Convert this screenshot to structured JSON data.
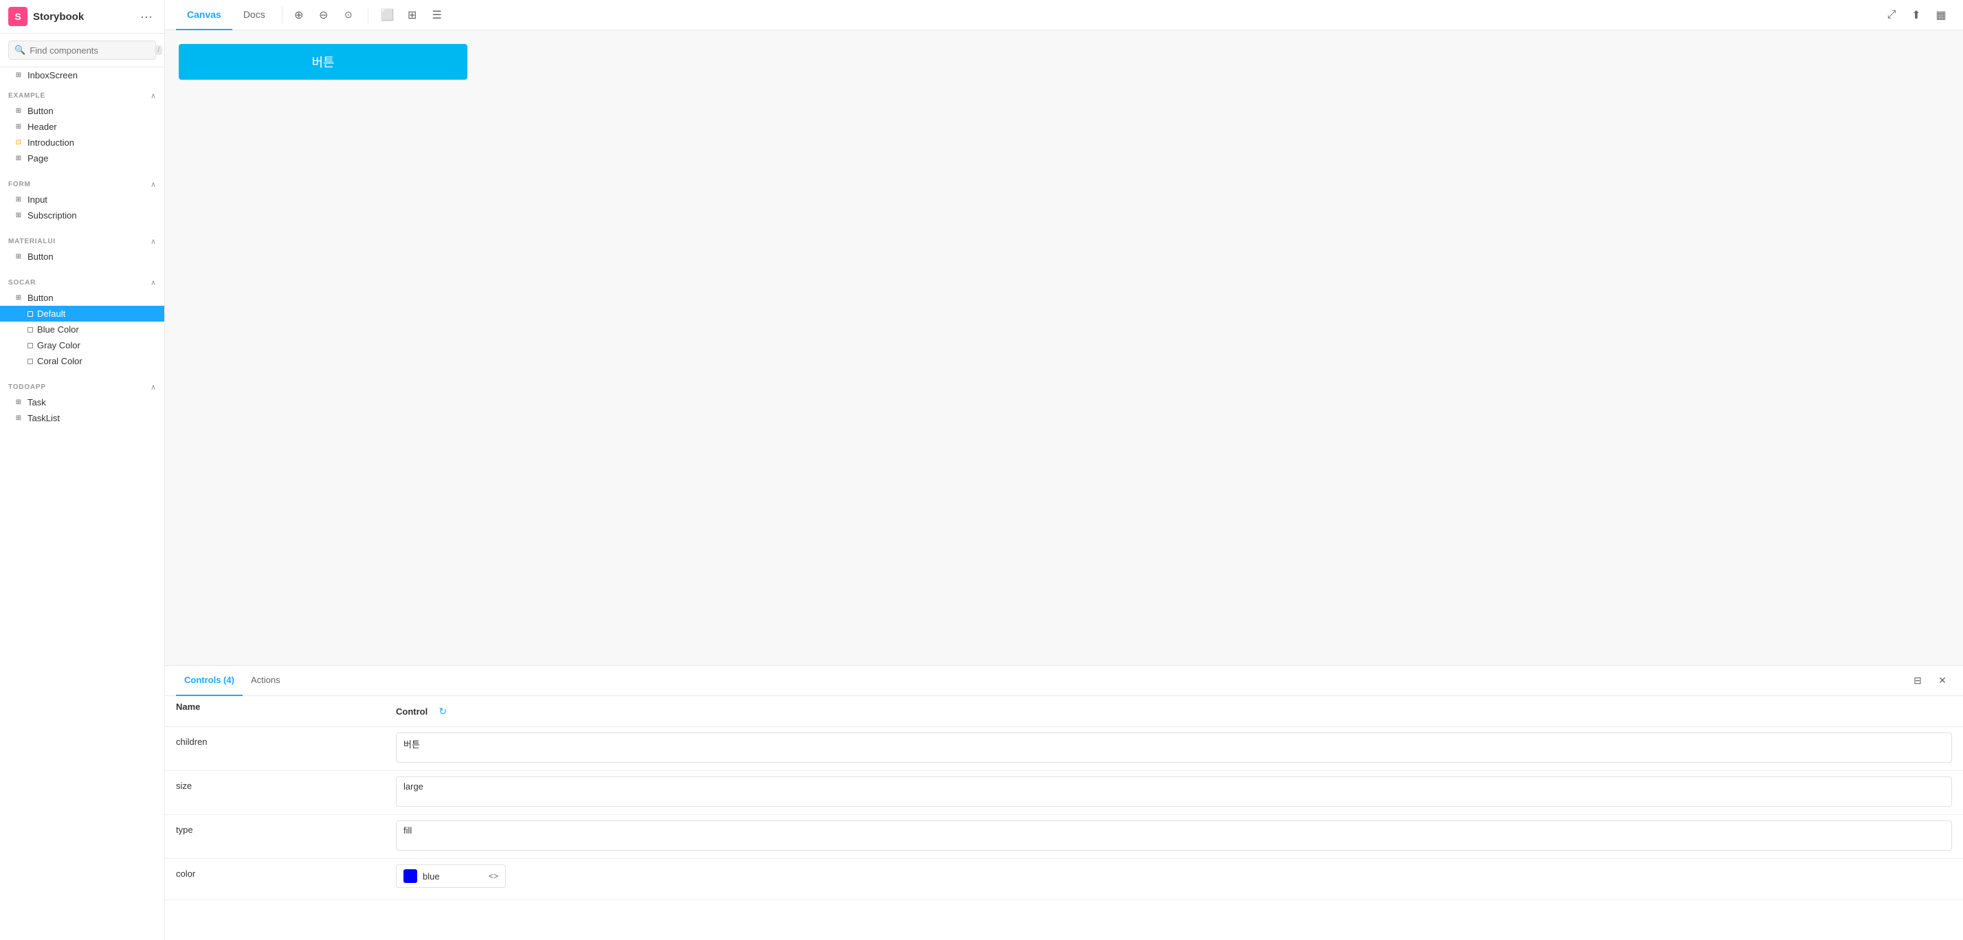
{
  "app": {
    "name": "Storybook",
    "logo_letter": "S"
  },
  "topbar": {
    "tabs": [
      {
        "label": "Canvas",
        "active": true
      },
      {
        "label": "Docs",
        "active": false
      }
    ],
    "tools": [
      "zoom-in",
      "zoom-out",
      "zoom-reset",
      "image-icon",
      "grid-icon",
      "layout-icon"
    ],
    "right_tools": [
      "expand-icon",
      "share-icon",
      "sidebar-icon"
    ]
  },
  "search": {
    "placeholder": "Find components",
    "shortcut": "/"
  },
  "sidebar": {
    "inbox": "InboxScreen",
    "sections": [
      {
        "title": "EXAMPLE",
        "collapsible": true,
        "items": [
          {
            "label": "Button",
            "icon": "book"
          },
          {
            "label": "Header",
            "icon": "book"
          },
          {
            "label": "Introduction",
            "icon": "orange"
          },
          {
            "label": "Page",
            "icon": "book"
          }
        ]
      },
      {
        "title": "FORM",
        "collapsible": true,
        "items": [
          {
            "label": "Input",
            "icon": "book"
          },
          {
            "label": "Subscription",
            "icon": "book"
          }
        ]
      },
      {
        "title": "MATERIALUI",
        "collapsible": true,
        "items": [
          {
            "label": "Button",
            "icon": "book"
          }
        ]
      },
      {
        "title": "SOCAR",
        "collapsible": true,
        "items": [
          {
            "label": "Button",
            "icon": "book",
            "expanded": true,
            "sub_items": [
              {
                "label": "Default",
                "active": true
              },
              {
                "label": "Blue Color",
                "active": false
              },
              {
                "label": "Gray Color",
                "active": false
              },
              {
                "label": "Coral Color",
                "active": false
              }
            ]
          }
        ]
      },
      {
        "title": "TODOAPP",
        "collapsible": true,
        "items": [
          {
            "label": "Task",
            "icon": "book"
          },
          {
            "label": "TaskList",
            "icon": "book"
          }
        ]
      }
    ]
  },
  "canvas": {
    "button_text": "버튼",
    "button_color": "#00b8f1"
  },
  "controls": {
    "tab_label": "Controls (4)",
    "actions_label": "Actions",
    "column_name": "Name",
    "column_control": "Control",
    "rows": [
      {
        "name": "children",
        "value": "버튼",
        "type": "textarea"
      },
      {
        "name": "size",
        "value": "large",
        "type": "textarea"
      },
      {
        "name": "type",
        "value": "fill",
        "type": "textarea"
      },
      {
        "name": "color",
        "value": "blue",
        "type": "color",
        "color": "#0000ff"
      }
    ]
  },
  "more_button_label": "···"
}
